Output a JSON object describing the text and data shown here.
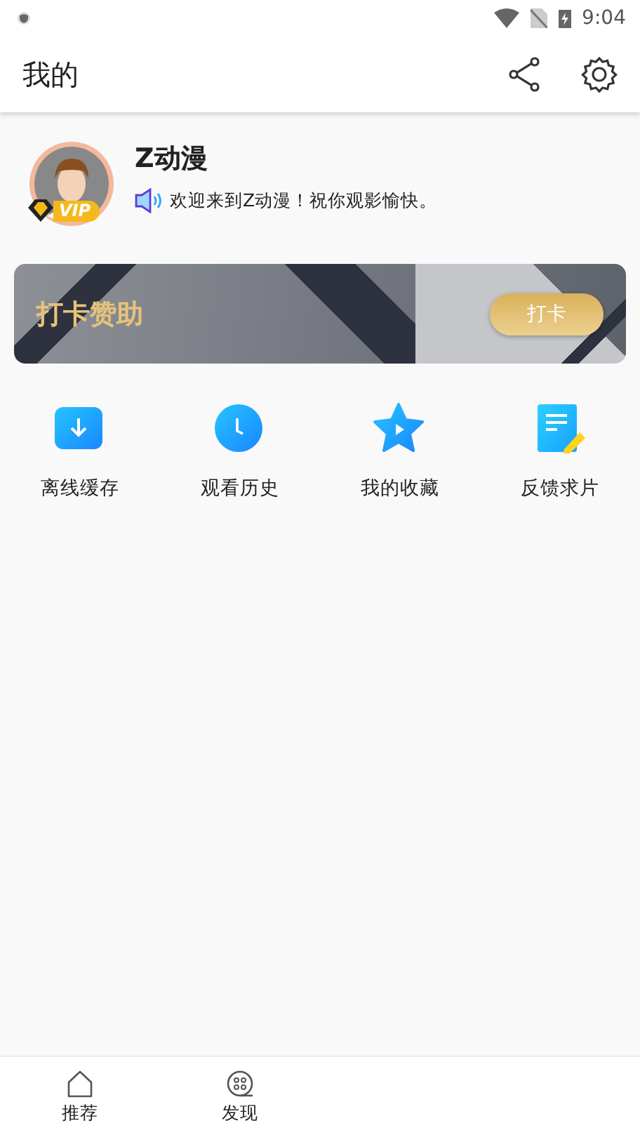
{
  "status_bar": {
    "time": "9:04"
  },
  "header": {
    "title": "我的"
  },
  "profile": {
    "name": "Z动漫",
    "badge": "VIP",
    "greeting": "欢迎来到Z动漫！祝你观影愉快。"
  },
  "banner": {
    "title": "打卡赞助",
    "button": "打卡"
  },
  "shortcuts": [
    {
      "kind": "download",
      "label": "离线缓存"
    },
    {
      "kind": "history",
      "label": "观看历史"
    },
    {
      "kind": "favorite",
      "label": "我的收藏"
    },
    {
      "kind": "feedback",
      "label": "反馈求片"
    }
  ],
  "bottom_nav": [
    {
      "kind": "home",
      "label": "推荐",
      "selected": false
    },
    {
      "kind": "discover",
      "label": "发现",
      "selected": false
    }
  ]
}
